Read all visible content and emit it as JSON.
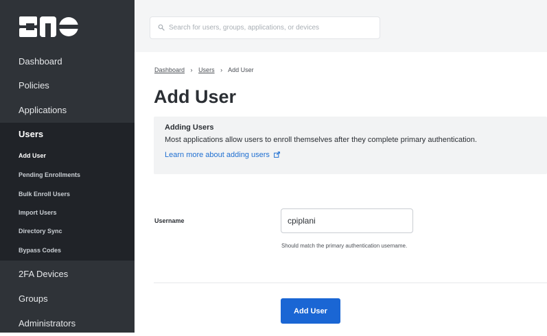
{
  "brand": {
    "logo_text": "DUO"
  },
  "sidebar": {
    "items": [
      {
        "label": "Dashboard"
      },
      {
        "label": "Policies"
      },
      {
        "label": "Applications"
      }
    ],
    "users_group": {
      "label": "Users",
      "subitems": [
        {
          "label": "Add User",
          "active": true
        },
        {
          "label": "Pending Enrollments"
        },
        {
          "label": "Bulk Enroll Users"
        },
        {
          "label": "Import Users"
        },
        {
          "label": "Directory Sync"
        },
        {
          "label": "Bypass Codes"
        }
      ]
    },
    "items_after": [
      {
        "label": "2FA Devices"
      },
      {
        "label": "Groups"
      },
      {
        "label": "Administrators"
      }
    ]
  },
  "search": {
    "placeholder": "Search for users, groups, applications, or devices",
    "icon": "search-icon"
  },
  "breadcrumb": [
    "Dashboard",
    "Users",
    "Add User"
  ],
  "page": {
    "title": "Add User",
    "info": {
      "title": "Adding Users",
      "text": "Most applications allow users to enroll themselves after they complete primary authentication.",
      "link_text": "Learn more about adding users"
    },
    "form": {
      "username_label": "Username",
      "username_value": "cpiplani",
      "username_help": "Should match the primary authentication username."
    },
    "primary_button_label": "Add User"
  },
  "colors": {
    "sidebar_bg": "#2f3338",
    "sidebar_group_bg": "#202328",
    "accent": "#1a66d4",
    "link": "#1f6fd1"
  }
}
